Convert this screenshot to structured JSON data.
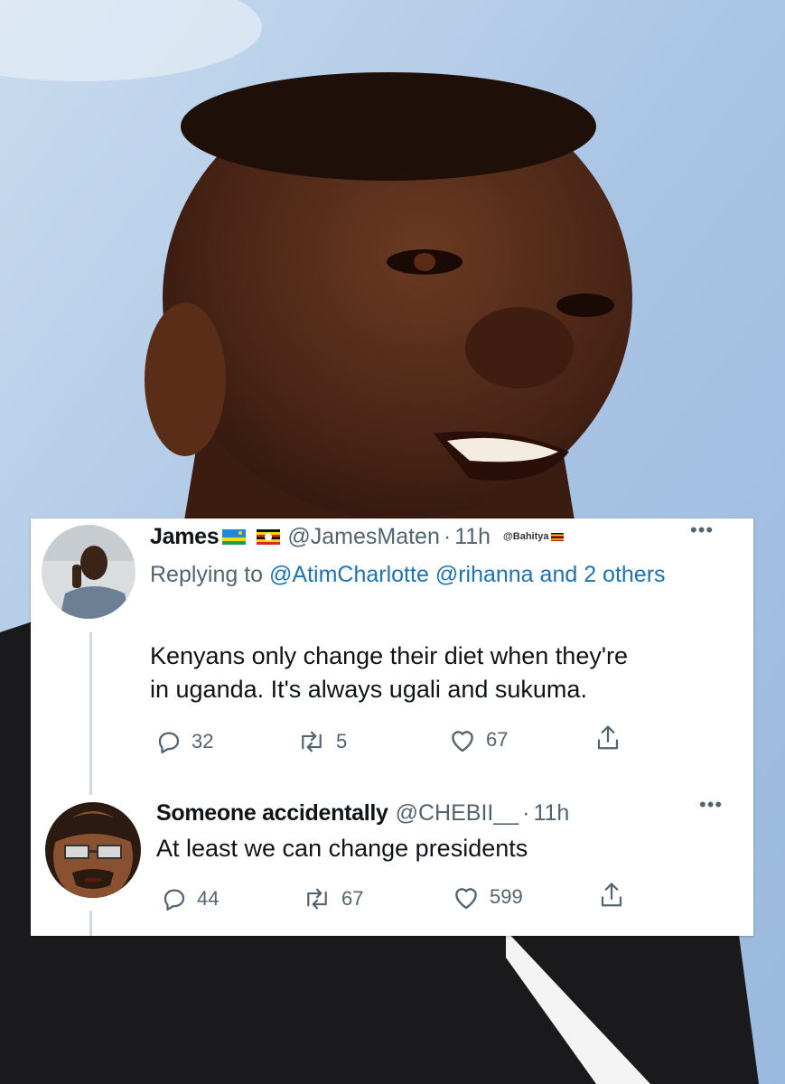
{
  "tweets": [
    {
      "display_name": "James",
      "handle": "@JamesMaten",
      "separator": "·",
      "time": "11h",
      "watermark": "@Bahitya",
      "replying_label": "Replying to",
      "mentions": [
        "@AtimCharlotte",
        "@rihanna"
      ],
      "and_others": "and 2 others",
      "text_lines": [
        "Kenyans only change their diet when they're",
        "in uganda. It's always ugali and sukuma."
      ],
      "replies": "32",
      "retweets": "5",
      "likes": "67"
    },
    {
      "display_name": "Someone accidentally",
      "handle": "@CHEBII__",
      "separator": "·",
      "time": "11h",
      "text": "At least we can change presidents",
      "replies": "44",
      "retweets": "67",
      "likes": "599"
    }
  ],
  "icons": {
    "reply": "speech-bubble",
    "retweet": "retweet-arrows",
    "like": "heart-outline",
    "share": "upload-arrow",
    "more": "ellipsis-horizontal",
    "flags": [
      "rwanda-flag",
      "uganda-flag"
    ]
  },
  "colors": {
    "mention_blue": "#1d72b6",
    "secondary_text": "#536471",
    "primary_text": "#0f1419",
    "thread_line": "#cfd9de",
    "sky_blue": "#aec8e6"
  }
}
